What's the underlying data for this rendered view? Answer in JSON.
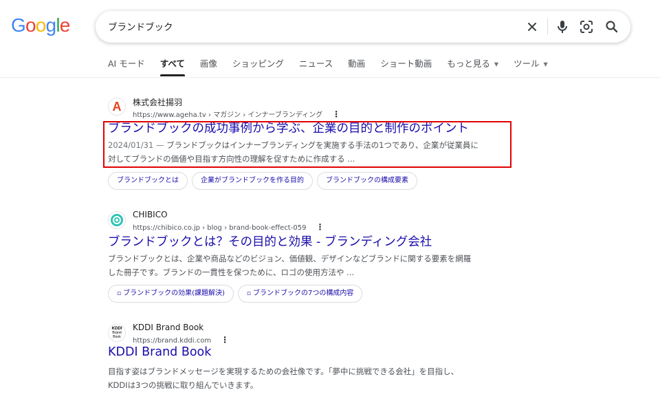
{
  "logo": {
    "letters": [
      "G",
      "o",
      "o",
      "g",
      "l",
      "e"
    ],
    "colors": [
      "#4285F4",
      "#EA4335",
      "#FBBC05",
      "#4285F4",
      "#34A853",
      "#EA4335"
    ]
  },
  "search": {
    "query": "ブランドブック",
    "icons": [
      "close-icon",
      "mic-icon",
      "camera-lens-icon",
      "search-icon"
    ]
  },
  "tabs": [
    {
      "label": "AI モード",
      "active": false
    },
    {
      "label": "すべて",
      "active": true
    },
    {
      "label": "画像",
      "active": false
    },
    {
      "label": "ショッピング",
      "active": false
    },
    {
      "label": "ニュース",
      "active": false
    },
    {
      "label": "動画",
      "active": false
    },
    {
      "label": "ショート動画",
      "active": false
    },
    {
      "label": "もっと見る",
      "active": false,
      "caret": "▼"
    },
    {
      "label": "ツール",
      "active": false,
      "caret": "▼"
    }
  ],
  "results": [
    {
      "site_name": "株式会社揚羽",
      "url": "https://www.ageha.tv › マガジン › インナーブランディング",
      "favicon_text": "A",
      "favicon_color": "#e8421b",
      "kebab": "⋮",
      "title": "ブランドブックの成功事例から学ぶ、企業の目的と制作のポイント",
      "date": "2024/01/31 —",
      "snippet_line1": "ブランドブックはインナーブランディングを実施する手法の1つであり、企業が従業員に",
      "snippet_line2": "対してブランドの価値や目指す方向性の理解を促すために作成する ...",
      "chips": [
        "ブランドブックとは",
        "企業がブランドブックを作る目的",
        "ブランドブックの構成要素"
      ]
    },
    {
      "site_name": "CHIBICO",
      "url": "https://chibico.co.jp › blog › brand-book-effect-059",
      "favicon_color": "#2ec4b6",
      "kebab": "⋮",
      "title": "ブランドブックとは？その目的と効果 - ブランディング会社",
      "snippet_line1": "ブランドブックとは、企業や商品などのビジョン、価値観、デザインなどブランドに関する要素を網羅",
      "snippet_line2": "した冊子です。ブランドの一貫性を保つために、ロゴの使用方法や ...",
      "chip_icon": "▫",
      "chips": [
        "ブランドブックの効果(課題解決)",
        "ブランドブックの7つの構成内容"
      ]
    },
    {
      "site_name": "KDDI Brand Book",
      "url": "https://brand.kddi.com",
      "favicon_lines": [
        "KDDI",
        "Brand",
        "Book"
      ],
      "kebab": "⋮",
      "title": "KDDI Brand Book",
      "snippet_line1": "目指す姿はブランドメッセージを実現するための会社像です。「夢中に挑戦できる会社」を目指し、",
      "snippet_line2": "KDDIは3つの挑戦に取り組んでいきます。"
    }
  ]
}
